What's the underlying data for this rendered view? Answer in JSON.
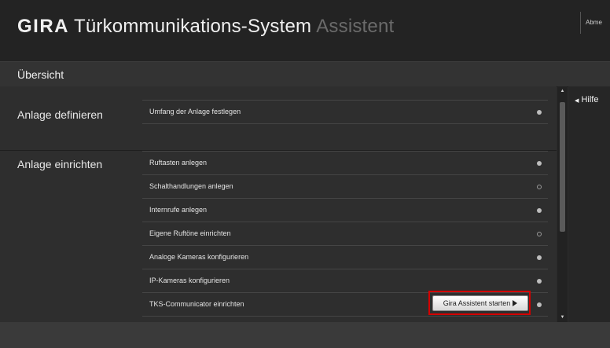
{
  "header": {
    "brand_logo": "GIRA",
    "brand_title": "Türkommunikations-System",
    "brand_suffix": "Assistent",
    "logout_label": "Abme"
  },
  "nav": {
    "active_tab": "Übersicht"
  },
  "sections": [
    {
      "title": "Anlage definieren",
      "items": [
        {
          "label": "Umfang der Anlage festlegen",
          "status": "filled"
        }
      ]
    },
    {
      "title": "Anlage einrichten",
      "items": [
        {
          "label": "Ruftasten anlegen",
          "status": "filled"
        },
        {
          "label": "Schalthandlungen anlegen",
          "status": "empty"
        },
        {
          "label": "Internrufe anlegen",
          "status": "filled"
        },
        {
          "label": "Eigene Ruftöne einrichten",
          "status": "empty"
        },
        {
          "label": "Analoge Kameras konfigurieren",
          "status": "filled"
        },
        {
          "label": "IP-Kameras konfigurieren",
          "status": "filled"
        },
        {
          "label": "TKS-Communicator einrichten",
          "status": "filled"
        }
      ]
    }
  ],
  "start_button_label": "Gira Assistent starten",
  "start_button_icon": "play-triangle",
  "help_label": "Hilfe",
  "colors": {
    "background": "#2b2b2b",
    "highlight": "#d40000"
  }
}
